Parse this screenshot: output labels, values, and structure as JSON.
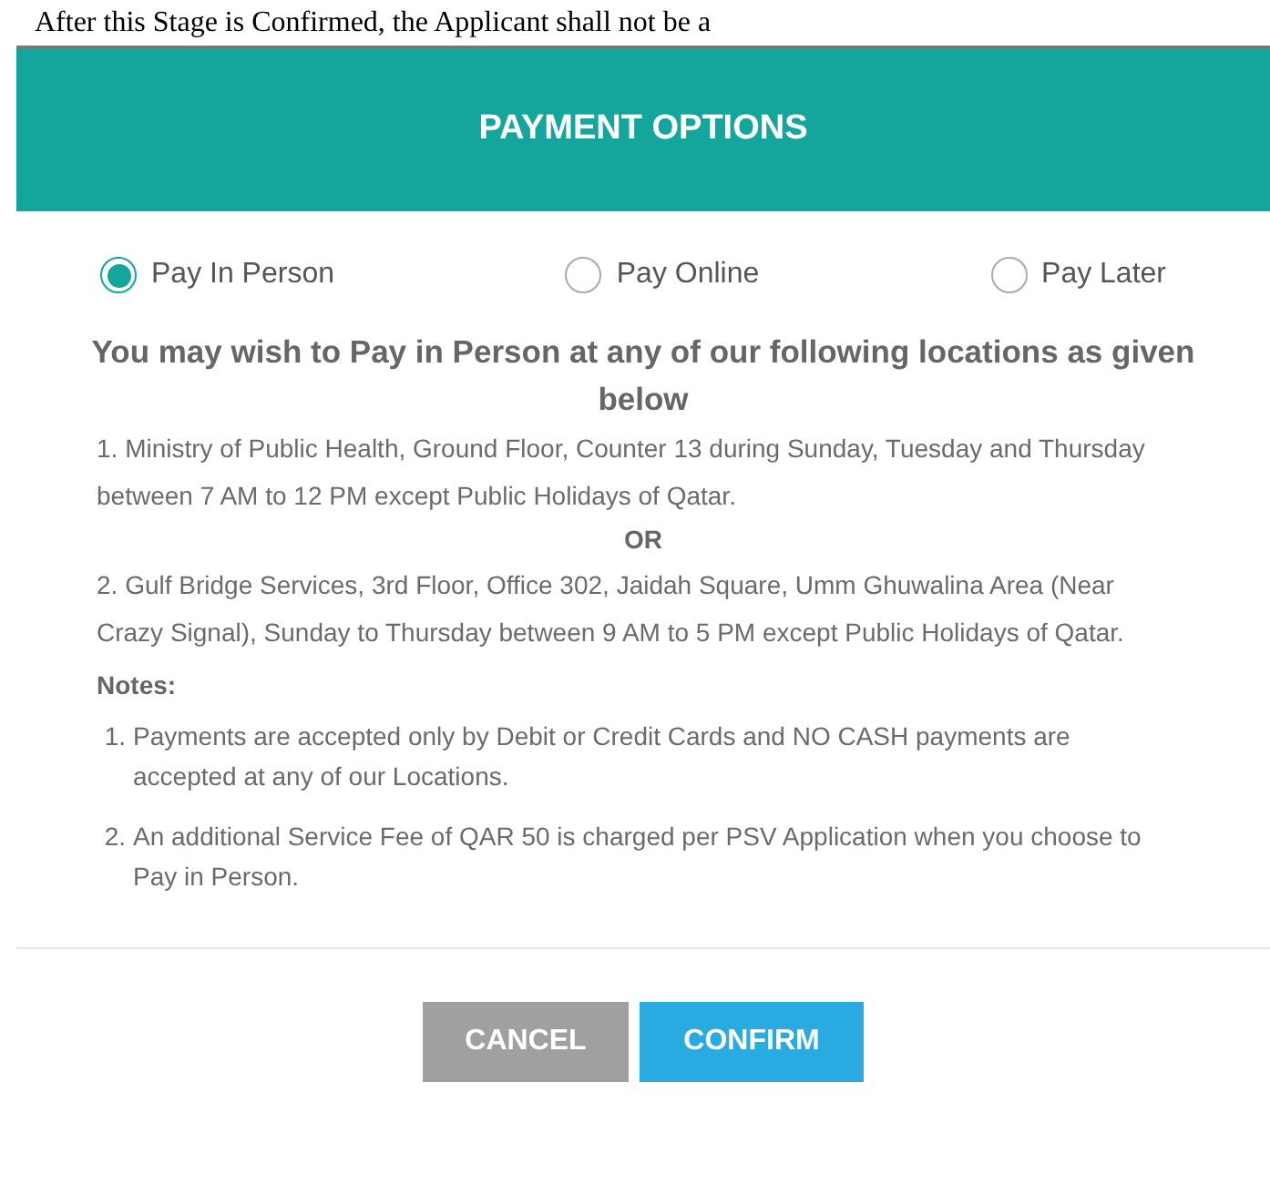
{
  "background_text": "After this Stage is Confirmed, the Applicant shall not be a",
  "dialog": {
    "title": "PAYMENT OPTIONS",
    "options": [
      {
        "label": "Pay In Person",
        "selected": true
      },
      {
        "label": "Pay Online",
        "selected": false
      },
      {
        "label": "Pay Later",
        "selected": false
      }
    ],
    "heading": "You may wish to Pay in Person at any of our following locations as given below",
    "locations": [
      "1. Ministry of Public Health, Ground Floor, Counter 13 during Sunday, Tuesday and Thursday between 7 AM to 12 PM except Public Holidays of Qatar.",
      "2. Gulf Bridge Services, 3rd Floor, Office 302, Jaidah Square, Umm Ghuwalina Area (Near Crazy Signal), Sunday to Thursday between 9 AM to 5 PM except Public Holidays of Qatar."
    ],
    "separator": "OR",
    "notes_title": "Notes:",
    "notes": [
      {
        "number": "1.",
        "text": "Payments are accepted only by Debit or Credit Cards and NO CASH payments are accepted at any of our Locations."
      },
      {
        "number": "2.",
        "text": "An additional Service Fee of QAR 50 is charged per PSV Application when you choose to Pay in Person."
      }
    ],
    "buttons": [
      {
        "label": "CANCEL",
        "kind": "secondary"
      },
      {
        "label": "CONFIRM",
        "kind": "primary"
      }
    ]
  }
}
